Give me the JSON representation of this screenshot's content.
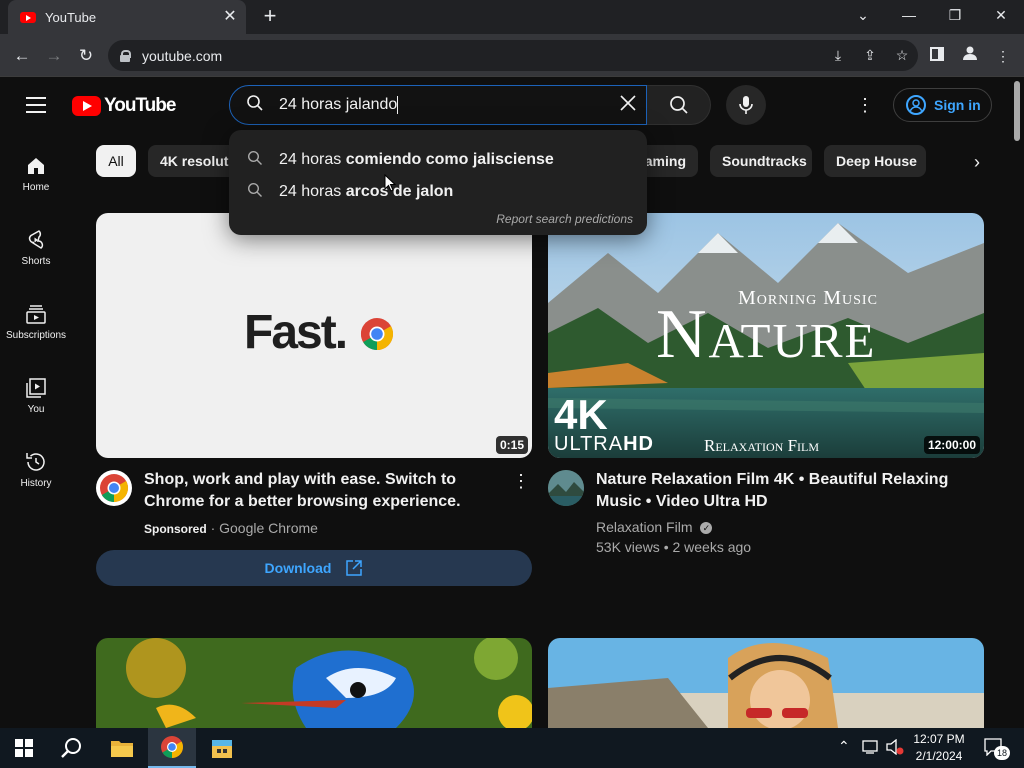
{
  "browser": {
    "tab_title": "YouTube",
    "url": "youtube.com"
  },
  "masthead": {
    "logo_text": "YouTube",
    "search_value": "24 horas jalando",
    "signin_label": "Sign in"
  },
  "guide": [
    {
      "label": "Home",
      "icon": "home-icon"
    },
    {
      "label": "Shorts",
      "icon": "shorts-icon"
    },
    {
      "label": "Subscriptions",
      "icon": "subscriptions-icon"
    },
    {
      "label": "You",
      "icon": "you-icon"
    },
    {
      "label": "History",
      "icon": "history-icon"
    }
  ],
  "chips": [
    "All",
    "4K resolution",
    "Gaming",
    "Soundtracks",
    "Deep House"
  ],
  "suggestions": [
    {
      "prefix": "24 horas ",
      "bold": "comiendo como jalisciense"
    },
    {
      "prefix": "24 horas ",
      "bold": "arcos de jalon"
    }
  ],
  "report_label": "Report search predictions",
  "videos": [
    {
      "thumb_text": "Fast.",
      "duration": "0:15",
      "title": "Shop, work and play with ease. Switch to Chrome for a better browsing experience.",
      "sponsored": "Sponsored",
      "channel": "Google Chrome",
      "cta": "Download"
    },
    {
      "thumb_top": "Morning Music",
      "thumb_big": "Nature",
      "thumb_4k": "4K",
      "thumb_ultra": "ULTRA",
      "thumb_hd": "HD",
      "thumb_film": "Relaxation Film",
      "duration": "12:00:00",
      "title": "Nature Relaxation Film 4K • Beautiful Relaxing Music • Video Ultra HD",
      "channel": "Relaxation Film",
      "stats": "53K views • 2 weeks ago"
    }
  ],
  "taskbar": {
    "time": "12:07 PM",
    "date": "2/1/2024",
    "notifications": "18"
  },
  "colors": {
    "yt_red": "#ff0000",
    "link_blue": "#3ea6ff",
    "bg": "#0f0f0f"
  }
}
